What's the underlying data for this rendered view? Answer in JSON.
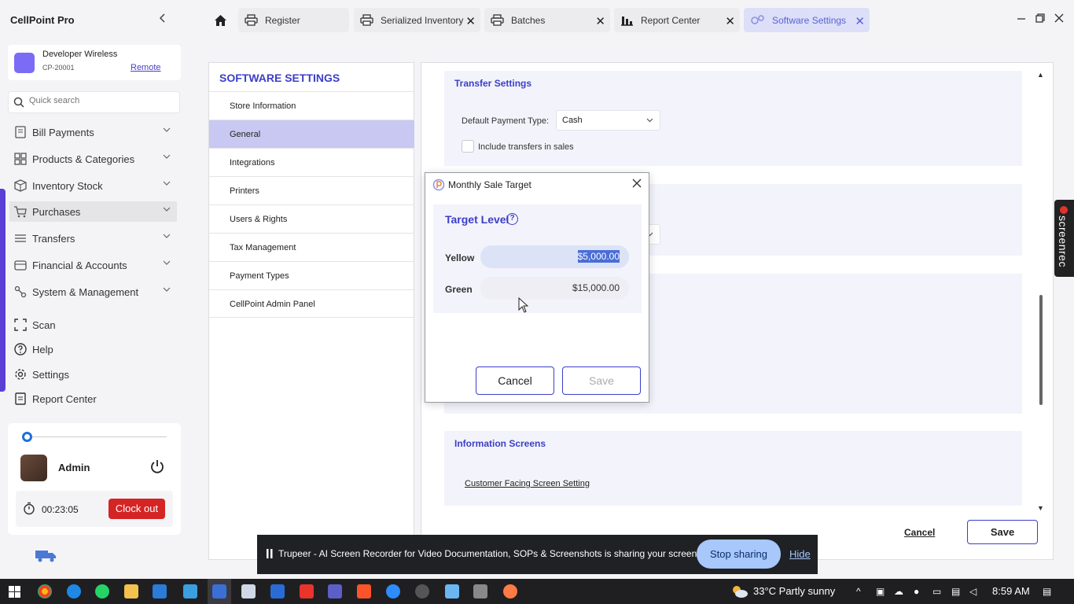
{
  "app": {
    "name": "CellPoint Pro",
    "collapse_icon": "chevron-left-icon"
  },
  "account": {
    "name": "Developer Wireless",
    "id": "CP-20001",
    "link": "Remote",
    "logo_color": "#7b6cf6"
  },
  "search": {
    "placeholder": "Quick search"
  },
  "nav": {
    "groups": [
      {
        "label": "Bill Payments",
        "icon": "receipt-icon"
      },
      {
        "label": "Products & Categories",
        "icon": "grid-icon"
      },
      {
        "label": "Inventory Stock",
        "icon": "box-icon"
      },
      {
        "label": "Purchases",
        "icon": "cart-icon"
      },
      {
        "label": "Transfers",
        "icon": "transfer-icon"
      },
      {
        "label": "Financial & Accounts",
        "icon": "wallet-icon"
      },
      {
        "label": "System & Management",
        "icon": "system-icon"
      }
    ],
    "links": [
      {
        "label": "Scan",
        "icon": "scan-icon"
      },
      {
        "label": "Help",
        "icon": "help-icon"
      },
      {
        "label": "Settings",
        "icon": "gear-icon"
      },
      {
        "label": "Report Center",
        "icon": "report-icon"
      }
    ]
  },
  "user": {
    "name": "Admin",
    "timer": "00:23:05",
    "clock_out": "Clock out"
  },
  "tabs": [
    {
      "label": "Register",
      "icon": "printer-icon"
    },
    {
      "label": "Serialized Inventory",
      "icon": "printer-icon"
    },
    {
      "label": "Batches",
      "icon": "printer-icon"
    },
    {
      "label": "Report Center",
      "icon": "bar-chart-icon"
    },
    {
      "label": "Software Settings",
      "icon": "settings-cogs-icon"
    }
  ],
  "settings": {
    "title": "SOFTWARE SETTINGS",
    "menu": [
      "Store Information",
      "General",
      "Integrations",
      "Printers",
      "Users & Rights",
      "Tax Management",
      "Payment Types",
      "CellPoint Admin Panel"
    ],
    "active_menu": "General"
  },
  "content": {
    "transfer": {
      "title": "Transfer Settings",
      "payment_label": "Default Payment Type:",
      "payment_value": "Cash",
      "include_label": "Include transfers in sales"
    },
    "info_screens": {
      "title": "Information Screens",
      "link": "Customer Facing Screen Setting"
    },
    "cancel": "Cancel",
    "save": "Save"
  },
  "modal": {
    "title": "Monthly Sale Target",
    "section": "Target Level",
    "help": "?",
    "levels": [
      {
        "label": "Yellow",
        "value": "$5,000.00"
      },
      {
        "label": "Green",
        "value": "$15,000.00"
      }
    ],
    "cancel": "Cancel",
    "save": "Save"
  },
  "sharing": {
    "message": "Trupeer - AI Screen Recorder for Video Documentation, SOPs & Screenshots is sharing your screen.",
    "stop": "Stop sharing",
    "hide": "Hide"
  },
  "screenrec": {
    "label": "screenrec"
  },
  "taskbar": {
    "weather": "33°C  Partly sunny",
    "time": "8:59 AM"
  }
}
